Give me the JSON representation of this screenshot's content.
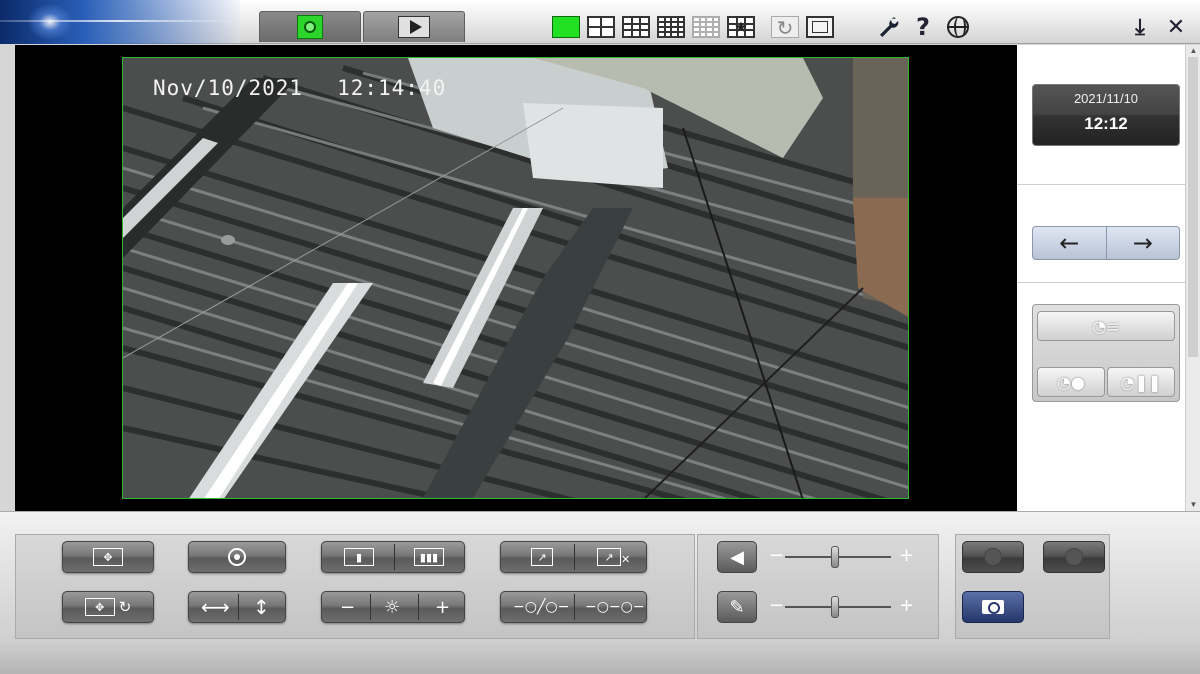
{
  "toolbar": {
    "tabs": [
      {
        "name": "live",
        "icon": "camera-icon",
        "active": true
      },
      {
        "name": "playback",
        "icon": "play-icon",
        "active": false
      }
    ],
    "layouts": [
      "single-view",
      "quad-view",
      "nine-view",
      "sixteen-view",
      "sixteen-view-disabled",
      "sequence-view",
      "refresh-icon",
      "fullscreen-icon"
    ],
    "active_color": "#22e022",
    "right_icons": [
      "wrench-icon",
      "help-icon",
      "globe-icon"
    ],
    "window_icons": [
      "download-icon",
      "close-icon"
    ],
    "help_glyph": "?",
    "close_glyph": "✕",
    "download_glyph": "⤓"
  },
  "video": {
    "osd_date": "Nov/10/2021",
    "osd_time": "12:14:40",
    "border_color": "#2fb52f"
  },
  "side": {
    "date": "2021/11/10",
    "time": "12:12",
    "prev_glyph": "←",
    "next_glyph": "→"
  },
  "controls": {
    "brightness_minus": "−",
    "brightness_plus": "+",
    "volume_minus": "−",
    "volume_plus": "+",
    "mic_minus": "−",
    "mic_plus": "+"
  }
}
